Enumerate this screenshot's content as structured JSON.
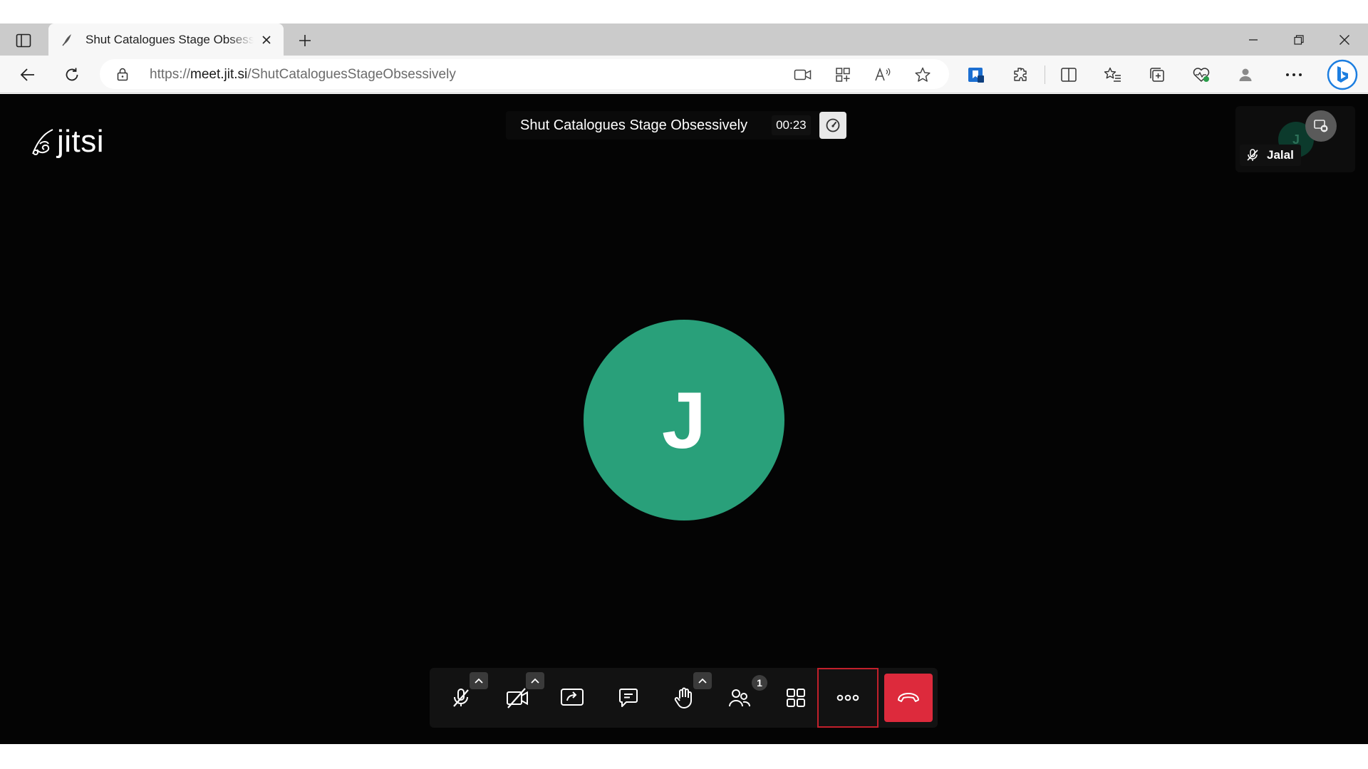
{
  "browser": {
    "tab": {
      "title": "Shut Catalogues Stage Obsessively"
    },
    "address": {
      "scheme": "https://",
      "host": "meet.jit.si",
      "path": "/ShutCataloguesStageObsessively"
    }
  },
  "meeting": {
    "logo_text": "jitsi",
    "subject": "Shut Catalogues Stage Obsessively",
    "timer": "00:23",
    "thumbnail": {
      "name": "Jalal",
      "initial": "J"
    },
    "main_avatar_initial": "J",
    "avatar_color": "#29a07a",
    "participants_count": "1",
    "hangup_color": "#dd2a3c"
  }
}
